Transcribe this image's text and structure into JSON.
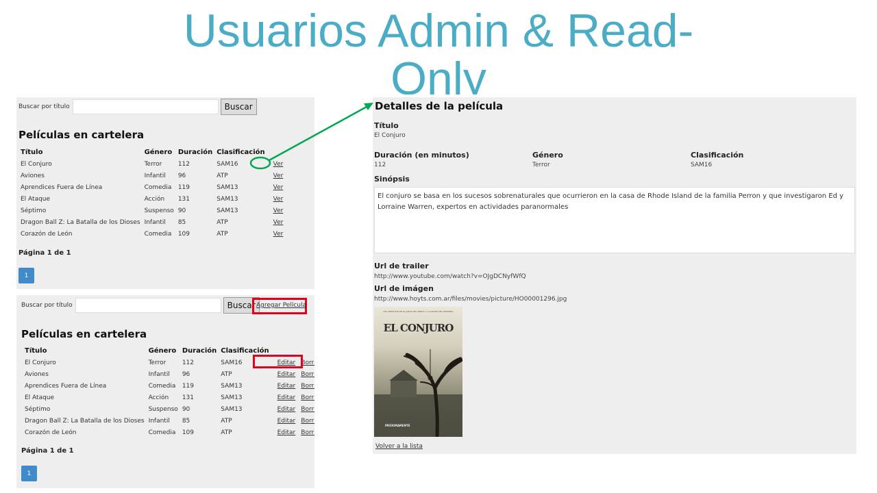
{
  "slide": {
    "title": "Usuarios Admin & Read-Only"
  },
  "readonly_panel": {
    "search": {
      "label": "Buscar por título",
      "value": "",
      "button": "Buscar"
    },
    "heading": "Películas en cartelera",
    "columns": [
      "Título",
      "Género",
      "Duración",
      "Clasificación"
    ],
    "rows": [
      {
        "titulo": "El Conjuro",
        "genero": "Terror",
        "duracion": "112",
        "clasificacion": "SAM16",
        "action": "Ver"
      },
      {
        "titulo": "Aviones",
        "genero": "Infantil",
        "duracion": "96",
        "clasificacion": "ATP",
        "action": "Ver"
      },
      {
        "titulo": "Aprendices Fuera de Línea",
        "genero": "Comedia",
        "duracion": "119",
        "clasificacion": "SAM13",
        "action": "Ver"
      },
      {
        "titulo": "El Ataque",
        "genero": "Acción",
        "duracion": "131",
        "clasificacion": "SAM13",
        "action": "Ver"
      },
      {
        "titulo": "Séptimo",
        "genero": "Suspenso",
        "duracion": "90",
        "clasificacion": "SAM13",
        "action": "Ver"
      },
      {
        "titulo": "Dragon Ball Z: La Batalla de los Dioses",
        "genero": "Infantil",
        "duracion": "85",
        "clasificacion": "ATP",
        "action": "Ver"
      },
      {
        "titulo": "Corazón de León",
        "genero": "Comedia",
        "duracion": "109",
        "clasificacion": "ATP",
        "action": "Ver"
      }
    ],
    "page_info": "Página 1 de 1",
    "current_page": "1"
  },
  "admin_panel": {
    "search": {
      "label": "Buscar por título",
      "value": "",
      "button": "Buscar"
    },
    "add_link": "Agregar Película",
    "heading": "Películas en cartelera",
    "columns": [
      "Título",
      "Género",
      "Duración",
      "Clasificación"
    ],
    "rows": [
      {
        "titulo": "El Conjuro",
        "genero": "Terror",
        "duracion": "112",
        "clasificacion": "SAM16",
        "edit": "Editar",
        "delete": "Borrar"
      },
      {
        "titulo": "Aviones",
        "genero": "Infantil",
        "duracion": "96",
        "clasificacion": "ATP",
        "edit": "Editar",
        "delete": "Borrar"
      },
      {
        "titulo": "Aprendices Fuera de Línea",
        "genero": "Comedia",
        "duracion": "119",
        "clasificacion": "SAM13",
        "edit": "Editar",
        "delete": "Borrar"
      },
      {
        "titulo": "El Ataque",
        "genero": "Acción",
        "duracion": "131",
        "clasificacion": "SAM13",
        "edit": "Editar",
        "delete": "Borrar"
      },
      {
        "titulo": "Séptimo",
        "genero": "Suspenso",
        "duracion": "90",
        "clasificacion": "SAM13",
        "edit": "Editar",
        "delete": "Borrar"
      },
      {
        "titulo": "Dragon Ball Z: La Batalla de los Dioses",
        "genero": "Infantil",
        "duracion": "85",
        "clasificacion": "ATP",
        "edit": "Editar",
        "delete": "Borrar"
      },
      {
        "titulo": "Corazón de León",
        "genero": "Comedia",
        "duracion": "109",
        "clasificacion": "ATP",
        "edit": "Editar",
        "delete": "Borrar"
      }
    ],
    "page_info": "Página 1 de 1",
    "current_page": "1"
  },
  "details": {
    "heading": "Detalles de la película",
    "title_label": "Título",
    "title_value": "El Conjuro",
    "duration_label": "Duración (en minutos)",
    "duration_value": "112",
    "genre_label": "Género",
    "genre_value": "Terror",
    "rating_label": "Clasificación",
    "rating_value": "SAM16",
    "synopsis_label": "Sinópsis",
    "synopsis_value": "El conjuro se basa en los sucesos sobrenaturales que ocurrieron en la casa de Rhode Island de la familia Perron y que investigaron Ed y Lorraine Warren, expertos en actividades paranormales",
    "trailer_label": "Url de trailer",
    "trailer_value": "http://www.youtube.com/watch?v=OJgDCNyfWfQ",
    "image_label": "Url de imágen",
    "image_value": "http://www.hoyts.com.ar/files/movies/picture/HO00001296.jpg",
    "poster": {
      "tagline": "DEL DIRECTOR DE EL JUEGO DEL MIEDO Y LA NOCHE DEL DEMONIO",
      "title": "EL CONJURO",
      "footer": "PRÓXIMAMENTE"
    },
    "back_link": "Volver a la lista"
  },
  "colors": {
    "title": "#4bacc6",
    "panel_bg": "#eeeeee",
    "highlight_red": "#e2001a",
    "arrow_green": "#00a84f",
    "page_button": "#428bca"
  },
  "icons": {
    "connector": "green-arrow-icon"
  }
}
